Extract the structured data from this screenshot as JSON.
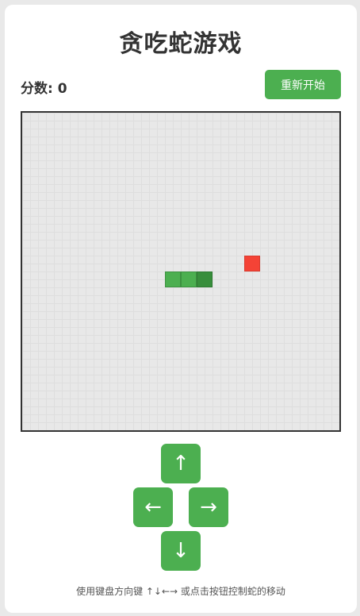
{
  "game": {
    "title": "贪吃蛇游戏",
    "score_label": "分数: ",
    "score_value": "0",
    "restart_label": "重新开始",
    "hint": "使用键盘方向键 ↑↓←→ 或点击按钮控制蛇的移动"
  },
  "board": {
    "cols": 20,
    "rows": 20,
    "snake": [
      {
        "x": 9,
        "y": 10
      },
      {
        "x": 10,
        "y": 10
      },
      {
        "x": 11,
        "y": 10
      }
    ],
    "head_index": 2,
    "food": {
      "x": 14,
      "y": 9
    },
    "colors": {
      "background": "#e8e8e8",
      "snake_body": "#4caf50",
      "snake_head": "#388e3c",
      "food": "#f44336",
      "button": "#4caf50"
    }
  },
  "controls": {
    "up": "↑",
    "left": "←",
    "right": "→",
    "down": "↓"
  }
}
